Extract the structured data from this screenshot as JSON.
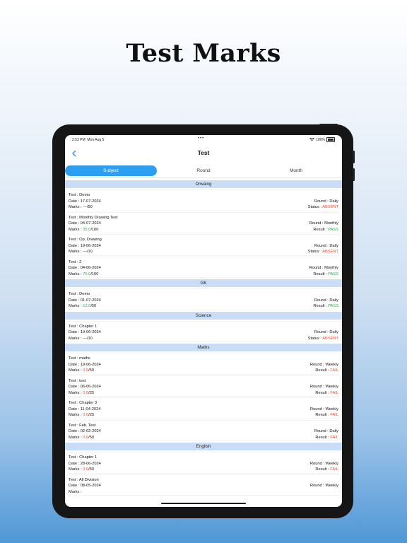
{
  "page": {
    "headline": "Test Marks"
  },
  "status_bar": {
    "time": "2:53 PM",
    "date": "Mon Aug 5",
    "dots": "•••",
    "battery": "100%"
  },
  "nav": {
    "back_icon": "chevron-left-icon",
    "title": "Test"
  },
  "tabs": [
    {
      "label": "Subject",
      "active": true
    },
    {
      "label": "Round",
      "active": false
    },
    {
      "label": "Month",
      "active": false
    }
  ],
  "colors": {
    "accent": "#2d9ff0",
    "section_bg": "#c9def6",
    "pass": "#2fa84f",
    "fail": "#e74c3c"
  },
  "sections": [
    {
      "title": "Drwaing",
      "entries": [
        {
          "test": "Test : Demo",
          "date": "Date : 17-07-2024",
          "marks_prefix": "Marks : ",
          "marks_value": "---",
          "marks_total": "/50",
          "round": "Round : Daily",
          "result_label": "Status : ",
          "result_value": "ABSENT",
          "tone": "bad"
        },
        {
          "test": "Test : Monthly Drawing Test",
          "date": "Date : 04-07-2024",
          "marks_prefix": "Marks : ",
          "marks_value": "35.0",
          "marks_total": "/100",
          "round": "Round : Monthly",
          "result_label": "Result : ",
          "result_value": "PASS",
          "tone": "good"
        },
        {
          "test": "Test : Op. Drawing",
          "date": "Date : 19-06-2024",
          "marks_prefix": "Marks : ",
          "marks_value": "---",
          "marks_total": "/10",
          "round": "Round : Daily",
          "result_label": "Status : ",
          "result_value": "ABSENT",
          "tone": "bad"
        },
        {
          "test": "Test : 2",
          "date": "Date : 04-06-2024",
          "marks_prefix": "Marks : ",
          "marks_value": "75.0",
          "marks_total": "/100",
          "round": "Round : Monthly",
          "result_label": "Result : ",
          "result_value": "PASS",
          "tone": "good"
        }
      ]
    },
    {
      "title": "GK",
      "entries": [
        {
          "test": "Test : Demo",
          "date": "Date : 01-07-2024",
          "marks_prefix": "Marks : ",
          "marks_value": "12.0",
          "marks_total": "/50",
          "round": "Round : Daily",
          "result_label": "Result : ",
          "result_value": "PASS",
          "tone": "good"
        }
      ]
    },
    {
      "title": "Science",
      "entries": [
        {
          "test": "Test : Chapter 1",
          "date": "Date : 19-06-2024",
          "marks_prefix": "Marks : ",
          "marks_value": "---",
          "marks_total": "/10",
          "round": "Round : Daily",
          "result_label": "Status : ",
          "result_value": "ABSENT",
          "tone": "bad"
        }
      ]
    },
    {
      "title": "Maths",
      "entries": [
        {
          "test": "Test : maths",
          "date": "Date : 19-06-2024",
          "marks_prefix": "Marks : ",
          "marks_value": "0.0",
          "marks_total": "/50",
          "round": "Round : Weekly",
          "result_label": "Result : ",
          "result_value": "FAIL",
          "tone": "bad"
        },
        {
          "test": "Test : test",
          "date": "Date : 06-06-2024",
          "marks_prefix": "Marks : ",
          "marks_value": "0.0",
          "marks_total": "/25",
          "round": "Round : Weekly",
          "result_label": "Result : ",
          "result_value": "FAIL",
          "tone": "bad"
        },
        {
          "test": "Test : Chapter 3",
          "date": "Date : 11-04-2024",
          "marks_prefix": "Marks : ",
          "marks_value": "0.0",
          "marks_total": "/25",
          "round": "Round : Weekly",
          "result_label": "Result : ",
          "result_value": "FAIL",
          "tone": "bad"
        },
        {
          "test": "Test : Feb. Test",
          "date": "Date : 02-02-2024",
          "marks_prefix": "Marks : ",
          "marks_value": "0.0",
          "marks_total": "/50",
          "round": "Round : Daily",
          "result_label": "Result : ",
          "result_value": "FAIL",
          "tone": "bad"
        }
      ]
    },
    {
      "title": "English",
      "entries": [
        {
          "test": "Test : Chapter 1",
          "date": "Date : 28-06-2024",
          "marks_prefix": "Marks : ",
          "marks_value": "0.0",
          "marks_total": "/50",
          "round": "Round : Weekly",
          "result_label": "Result : ",
          "result_value": "FAIL",
          "tone": "bad"
        },
        {
          "test": "Test : All Division",
          "date": "Date : 08-05-2024",
          "marks_prefix": "Marks : ",
          "marks_value": "",
          "marks_total": "",
          "round": "Round : Weekly",
          "result_label": "",
          "result_value": "",
          "tone": "bad"
        }
      ]
    }
  ]
}
